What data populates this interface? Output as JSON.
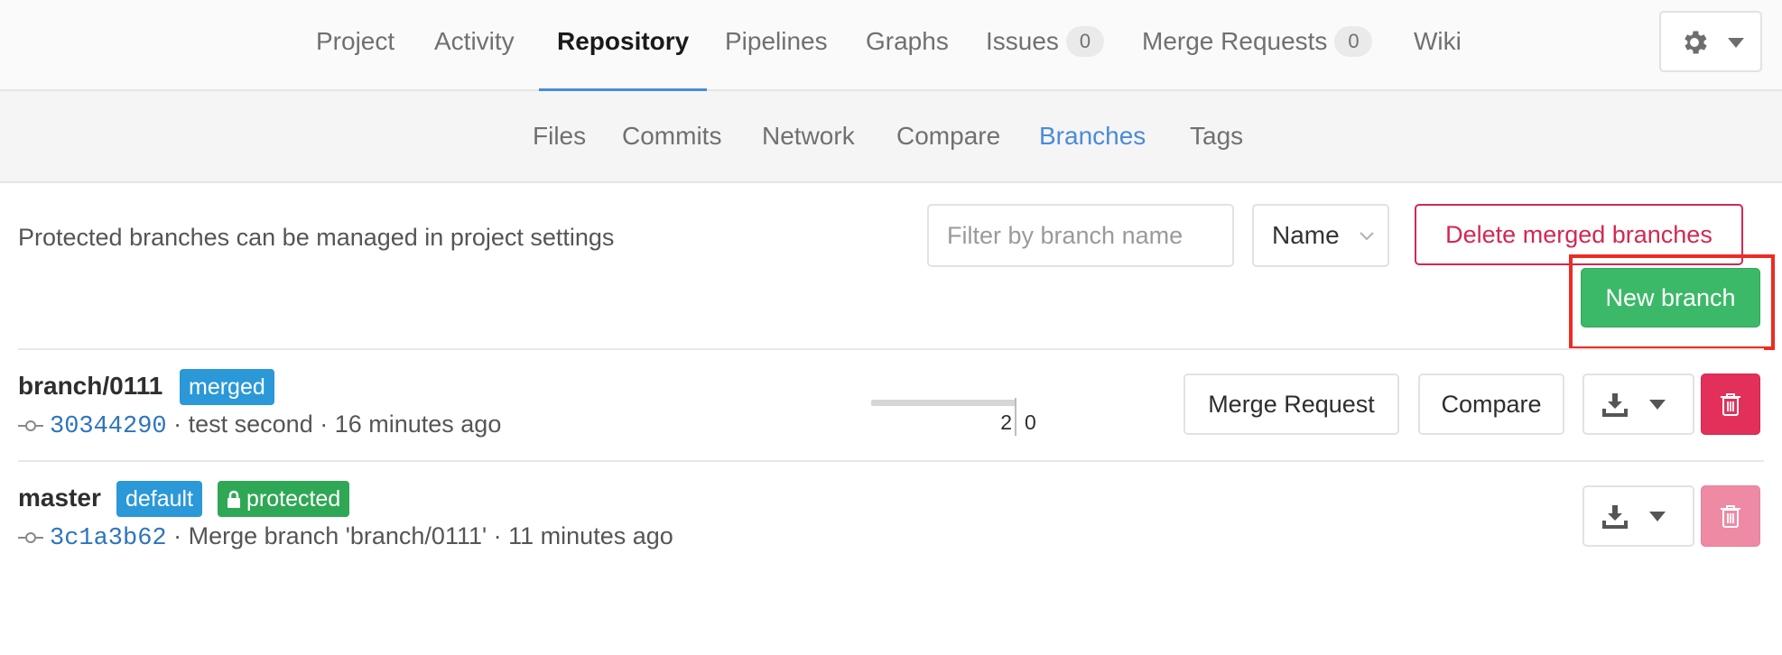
{
  "top_nav": {
    "tabs": [
      {
        "label": "Project"
      },
      {
        "label": "Activity"
      },
      {
        "label": "Repository",
        "active": true
      },
      {
        "label": "Pipelines"
      },
      {
        "label": "Graphs"
      },
      {
        "label": "Issues",
        "count": "0"
      },
      {
        "label": "Merge Requests",
        "count": "0"
      },
      {
        "label": "Wiki"
      }
    ],
    "settings_icon": "gear-icon"
  },
  "sub_nav": {
    "tabs": [
      {
        "label": "Files"
      },
      {
        "label": "Commits"
      },
      {
        "label": "Network"
      },
      {
        "label": "Compare"
      },
      {
        "label": "Branches",
        "active": true
      },
      {
        "label": "Tags"
      }
    ]
  },
  "controls": {
    "protected_note": "Protected branches can be managed in project settings",
    "filter_placeholder": "Filter by branch name",
    "filter_value": "",
    "sort_label": "Name",
    "delete_merged_label": "Delete merged branches",
    "new_branch_label": "New branch"
  },
  "branches": [
    {
      "name": "branch/0111",
      "badges": [
        "merged"
      ],
      "sha": "30344290",
      "message": "· test second · 16 minutes ago",
      "behind": "2",
      "ahead": "0",
      "merge_request_label": "Merge Request",
      "compare_label": "Compare",
      "delete_enabled": true
    },
    {
      "name": "master",
      "badges": [
        "default",
        "protected"
      ],
      "sha": "3c1a3b62",
      "message": "· Merge branch 'branch/0111' · 11 minutes ago",
      "delete_enabled": false
    }
  ],
  "colors": {
    "accent_blue": "#4a8bd8",
    "danger": "#d22852",
    "success": "#3cb968",
    "badge_blue": "#2b98d8",
    "badge_green": "#2ea855",
    "highlight_red": "#ee2b22"
  }
}
